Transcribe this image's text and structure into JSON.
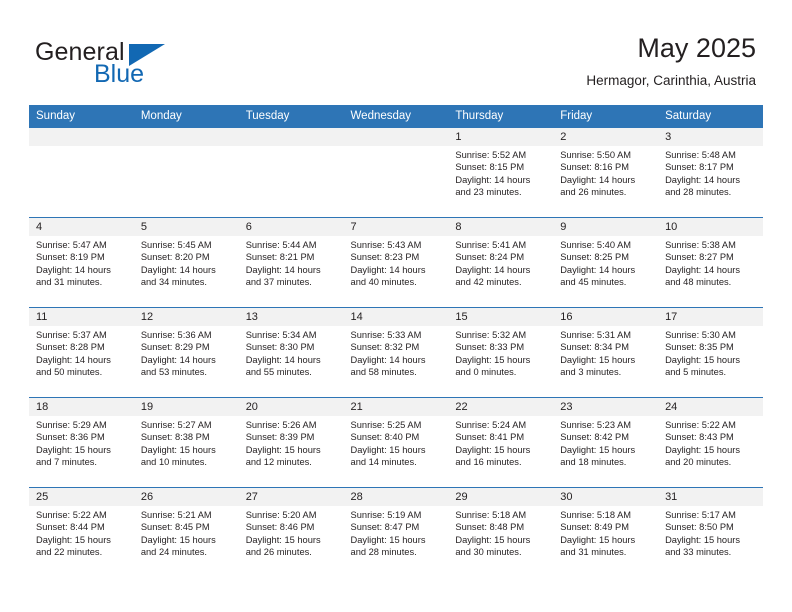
{
  "brand": {
    "name_part1": "General",
    "name_part2": "Blue",
    "triangle_color": "#1268b3",
    "accent_color": "#2e75b6"
  },
  "header": {
    "title": "May 2025",
    "subtitle": "Hermagor, Carinthia, Austria"
  },
  "weekday_headers": [
    "Sunday",
    "Monday",
    "Tuesday",
    "Wednesday",
    "Thursday",
    "Friday",
    "Saturday"
  ],
  "labels": {
    "sunrise_prefix": "Sunrise:",
    "sunset_prefix": "Sunset:",
    "daylight_prefix": "Daylight:"
  },
  "weeks": [
    [
      {
        "day": "",
        "line1": "",
        "line2": "",
        "line3": "",
        "line4": ""
      },
      {
        "day": "",
        "line1": "",
        "line2": "",
        "line3": "",
        "line4": ""
      },
      {
        "day": "",
        "line1": "",
        "line2": "",
        "line3": "",
        "line4": ""
      },
      {
        "day": "",
        "line1": "",
        "line2": "",
        "line3": "",
        "line4": ""
      },
      {
        "day": "1",
        "line1": "Sunrise: 5:52 AM",
        "line2": "Sunset: 8:15 PM",
        "line3": "Daylight: 14 hours",
        "line4": "and 23 minutes."
      },
      {
        "day": "2",
        "line1": "Sunrise: 5:50 AM",
        "line2": "Sunset: 8:16 PM",
        "line3": "Daylight: 14 hours",
        "line4": "and 26 minutes."
      },
      {
        "day": "3",
        "line1": "Sunrise: 5:48 AM",
        "line2": "Sunset: 8:17 PM",
        "line3": "Daylight: 14 hours",
        "line4": "and 28 minutes."
      }
    ],
    [
      {
        "day": "4",
        "line1": "Sunrise: 5:47 AM",
        "line2": "Sunset: 8:19 PM",
        "line3": "Daylight: 14 hours",
        "line4": "and 31 minutes."
      },
      {
        "day": "5",
        "line1": "Sunrise: 5:45 AM",
        "line2": "Sunset: 8:20 PM",
        "line3": "Daylight: 14 hours",
        "line4": "and 34 minutes."
      },
      {
        "day": "6",
        "line1": "Sunrise: 5:44 AM",
        "line2": "Sunset: 8:21 PM",
        "line3": "Daylight: 14 hours",
        "line4": "and 37 minutes."
      },
      {
        "day": "7",
        "line1": "Sunrise: 5:43 AM",
        "line2": "Sunset: 8:23 PM",
        "line3": "Daylight: 14 hours",
        "line4": "and 40 minutes."
      },
      {
        "day": "8",
        "line1": "Sunrise: 5:41 AM",
        "line2": "Sunset: 8:24 PM",
        "line3": "Daylight: 14 hours",
        "line4": "and 42 minutes."
      },
      {
        "day": "9",
        "line1": "Sunrise: 5:40 AM",
        "line2": "Sunset: 8:25 PM",
        "line3": "Daylight: 14 hours",
        "line4": "and 45 minutes."
      },
      {
        "day": "10",
        "line1": "Sunrise: 5:38 AM",
        "line2": "Sunset: 8:27 PM",
        "line3": "Daylight: 14 hours",
        "line4": "and 48 minutes."
      }
    ],
    [
      {
        "day": "11",
        "line1": "Sunrise: 5:37 AM",
        "line2": "Sunset: 8:28 PM",
        "line3": "Daylight: 14 hours",
        "line4": "and 50 minutes."
      },
      {
        "day": "12",
        "line1": "Sunrise: 5:36 AM",
        "line2": "Sunset: 8:29 PM",
        "line3": "Daylight: 14 hours",
        "line4": "and 53 minutes."
      },
      {
        "day": "13",
        "line1": "Sunrise: 5:34 AM",
        "line2": "Sunset: 8:30 PM",
        "line3": "Daylight: 14 hours",
        "line4": "and 55 minutes."
      },
      {
        "day": "14",
        "line1": "Sunrise: 5:33 AM",
        "line2": "Sunset: 8:32 PM",
        "line3": "Daylight: 14 hours",
        "line4": "and 58 minutes."
      },
      {
        "day": "15",
        "line1": "Sunrise: 5:32 AM",
        "line2": "Sunset: 8:33 PM",
        "line3": "Daylight: 15 hours",
        "line4": "and 0 minutes."
      },
      {
        "day": "16",
        "line1": "Sunrise: 5:31 AM",
        "line2": "Sunset: 8:34 PM",
        "line3": "Daylight: 15 hours",
        "line4": "and 3 minutes."
      },
      {
        "day": "17",
        "line1": "Sunrise: 5:30 AM",
        "line2": "Sunset: 8:35 PM",
        "line3": "Daylight: 15 hours",
        "line4": "and 5 minutes."
      }
    ],
    [
      {
        "day": "18",
        "line1": "Sunrise: 5:29 AM",
        "line2": "Sunset: 8:36 PM",
        "line3": "Daylight: 15 hours",
        "line4": "and 7 minutes."
      },
      {
        "day": "19",
        "line1": "Sunrise: 5:27 AM",
        "line2": "Sunset: 8:38 PM",
        "line3": "Daylight: 15 hours",
        "line4": "and 10 minutes."
      },
      {
        "day": "20",
        "line1": "Sunrise: 5:26 AM",
        "line2": "Sunset: 8:39 PM",
        "line3": "Daylight: 15 hours",
        "line4": "and 12 minutes."
      },
      {
        "day": "21",
        "line1": "Sunrise: 5:25 AM",
        "line2": "Sunset: 8:40 PM",
        "line3": "Daylight: 15 hours",
        "line4": "and 14 minutes."
      },
      {
        "day": "22",
        "line1": "Sunrise: 5:24 AM",
        "line2": "Sunset: 8:41 PM",
        "line3": "Daylight: 15 hours",
        "line4": "and 16 minutes."
      },
      {
        "day": "23",
        "line1": "Sunrise: 5:23 AM",
        "line2": "Sunset: 8:42 PM",
        "line3": "Daylight: 15 hours",
        "line4": "and 18 minutes."
      },
      {
        "day": "24",
        "line1": "Sunrise: 5:22 AM",
        "line2": "Sunset: 8:43 PM",
        "line3": "Daylight: 15 hours",
        "line4": "and 20 minutes."
      }
    ],
    [
      {
        "day": "25",
        "line1": "Sunrise: 5:22 AM",
        "line2": "Sunset: 8:44 PM",
        "line3": "Daylight: 15 hours",
        "line4": "and 22 minutes."
      },
      {
        "day": "26",
        "line1": "Sunrise: 5:21 AM",
        "line2": "Sunset: 8:45 PM",
        "line3": "Daylight: 15 hours",
        "line4": "and 24 minutes."
      },
      {
        "day": "27",
        "line1": "Sunrise: 5:20 AM",
        "line2": "Sunset: 8:46 PM",
        "line3": "Daylight: 15 hours",
        "line4": "and 26 minutes."
      },
      {
        "day": "28",
        "line1": "Sunrise: 5:19 AM",
        "line2": "Sunset: 8:47 PM",
        "line3": "Daylight: 15 hours",
        "line4": "and 28 minutes."
      },
      {
        "day": "29",
        "line1": "Sunrise: 5:18 AM",
        "line2": "Sunset: 8:48 PM",
        "line3": "Daylight: 15 hours",
        "line4": "and 30 minutes."
      },
      {
        "day": "30",
        "line1": "Sunrise: 5:18 AM",
        "line2": "Sunset: 8:49 PM",
        "line3": "Daylight: 15 hours",
        "line4": "and 31 minutes."
      },
      {
        "day": "31",
        "line1": "Sunrise: 5:17 AM",
        "line2": "Sunset: 8:50 PM",
        "line3": "Daylight: 15 hours",
        "line4": "and 33 minutes."
      }
    ]
  ]
}
